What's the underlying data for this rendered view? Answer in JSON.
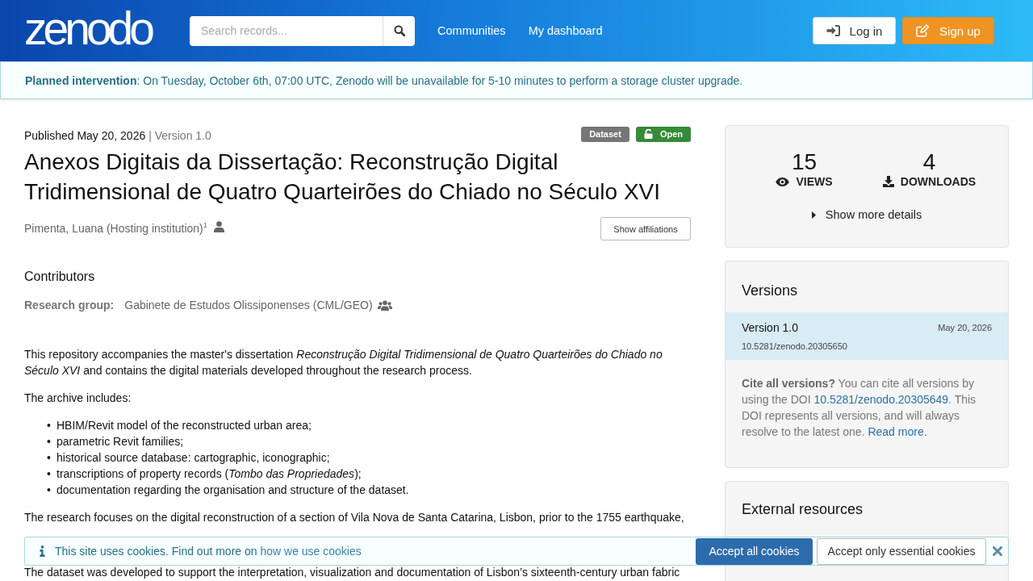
{
  "header": {
    "logo": "zenodo",
    "search": {
      "placeholder": "Search records..."
    },
    "nav": [
      {
        "label": "Communities"
      },
      {
        "label": "My dashboard"
      }
    ],
    "buttons": [
      {
        "label": "Log in",
        "kind": "login"
      },
      {
        "label": "Sign up",
        "kind": "signup"
      }
    ]
  },
  "announcement": {
    "text": "**Planned intervention**: On Tuesday, October 6th, 07:00 UTC, Zenodo will be unavailable for 5-10 minutes to perform a storage cluster upgrade."
  },
  "record": {
    "published": "Published May 20, 2026",
    "version": "| Version 1.0",
    "labels": [
      {
        "label": "Dataset",
        "kind": "resource_type"
      },
      {
        "label": "Open",
        "kind": "access"
      }
    ],
    "title": "Anexos Digitais da Dissertação: Reconstrução Digital Tridimensional de Quatro Quarteirões do Chiado no Século XVI",
    "creators": [
      {
        "name": "Pimenta, Luana (Hosting institution)$^{1}$"
      }
    ],
    "show_affiliations": "Show affiliations",
    "contributors": {
      "heading": "Contributors",
      "items": [
        {
          "role": "Research group:",
          "name": "Gabinete de Estudos Olissiponenses (CML/GEO)"
        }
      ]
    },
    "description": [
      {
        "kind": "paragraph",
        "text": "This repository accompanies the master's dissertation *Reconstrução Digital Tridimensional de Quatro Quarteirões do Chiado no Século XVI* and contains the digital materials developed throughout the research process."
      },
      {
        "kind": "paragraph",
        "text": "The archive includes:"
      },
      {
        "kind": "list",
        "items": [
          {
            "marker": "•",
            "text": "HBIM/Revit model of the reconstructed urban area;"
          },
          {
            "marker": "•",
            "text": "parametric Revit families;"
          },
          {
            "marker": "•",
            "text": "historical source database: cartographic, iconographic;"
          },
          {
            "marker": "•",
            "text": "transcriptions of property records (*Tombo das Propriedades*);"
          },
          {
            "marker": "•",
            "text": "documentation regarding the organisation and structure of the dataset."
          }
        ]
      },
      {
        "kind": "paragraph",
        "text": "The research focuses on the digital reconstruction of a section of Vila Nova de Santa Catarina, Lisbon, prior to the 1755 earthquake,"
      },
      {
        "kind": "paragraph",
        "text": "The dataset was developed to support the interpretation, visualization and documentation of Lisbon’s sixteenth-century urban fabric"
      }
    ]
  },
  "sidebar": {
    "stats": {
      "items": [
        {
          "value": "15",
          "label": "VIEWS",
          "kind": "views"
        },
        {
          "value": "4",
          "label": "DOWNLOADS",
          "kind": "downloads"
        }
      ],
      "details": {
        "label": "Show more details",
        "expanded": false
      }
    },
    "versions": {
      "heading": "Versions",
      "items": [
        {
          "label": "Version 1.0",
          "date": "May 20, 2026",
          "doi": "10.5281/zenodo.20305650",
          "selected": true
        }
      ],
      "cite": [
        {
          "kind": "text",
          "text": "**Cite all versions?** You can cite all versions by using the DOI "
        },
        {
          "kind": "link",
          "text": "10.5281/zenodo.20305649"
        },
        {
          "kind": "text",
          "text": ". This DOI represents all versions, and will always resolve to the latest one. "
        },
        {
          "kind": "link",
          "text": "Read more."
        }
      ]
    },
    "external": {
      "heading": "External resources"
    }
  },
  "cookie_banner": {
    "text": [
      {
        "kind": "text",
        "text": "This site uses cookies. Find out more on "
      },
      {
        "kind": "link",
        "text": "how we use cookies"
      }
    ],
    "buttons": [
      {
        "label": "Accept all cookies",
        "kind": "primary"
      },
      {
        "label": "Accept only essential cookies",
        "kind": "secondary"
      }
    ]
  }
}
